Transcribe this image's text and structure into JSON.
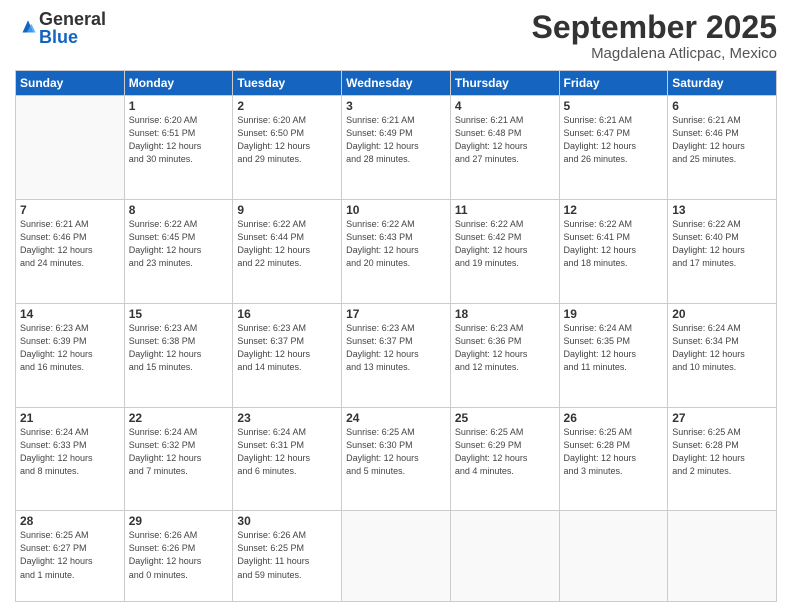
{
  "logo": {
    "general": "General",
    "blue": "Blue"
  },
  "header": {
    "month": "September 2025",
    "location": "Magdalena Atlicpac, Mexico"
  },
  "days_of_week": [
    "Sunday",
    "Monday",
    "Tuesday",
    "Wednesday",
    "Thursday",
    "Friday",
    "Saturday"
  ],
  "weeks": [
    [
      {
        "day": "",
        "info": ""
      },
      {
        "day": "1",
        "info": "Sunrise: 6:20 AM\nSunset: 6:51 PM\nDaylight: 12 hours\nand 30 minutes."
      },
      {
        "day": "2",
        "info": "Sunrise: 6:20 AM\nSunset: 6:50 PM\nDaylight: 12 hours\nand 29 minutes."
      },
      {
        "day": "3",
        "info": "Sunrise: 6:21 AM\nSunset: 6:49 PM\nDaylight: 12 hours\nand 28 minutes."
      },
      {
        "day": "4",
        "info": "Sunrise: 6:21 AM\nSunset: 6:48 PM\nDaylight: 12 hours\nand 27 minutes."
      },
      {
        "day": "5",
        "info": "Sunrise: 6:21 AM\nSunset: 6:47 PM\nDaylight: 12 hours\nand 26 minutes."
      },
      {
        "day": "6",
        "info": "Sunrise: 6:21 AM\nSunset: 6:46 PM\nDaylight: 12 hours\nand 25 minutes."
      }
    ],
    [
      {
        "day": "7",
        "info": "Sunrise: 6:21 AM\nSunset: 6:46 PM\nDaylight: 12 hours\nand 24 minutes."
      },
      {
        "day": "8",
        "info": "Sunrise: 6:22 AM\nSunset: 6:45 PM\nDaylight: 12 hours\nand 23 minutes."
      },
      {
        "day": "9",
        "info": "Sunrise: 6:22 AM\nSunset: 6:44 PM\nDaylight: 12 hours\nand 22 minutes."
      },
      {
        "day": "10",
        "info": "Sunrise: 6:22 AM\nSunset: 6:43 PM\nDaylight: 12 hours\nand 20 minutes."
      },
      {
        "day": "11",
        "info": "Sunrise: 6:22 AM\nSunset: 6:42 PM\nDaylight: 12 hours\nand 19 minutes."
      },
      {
        "day": "12",
        "info": "Sunrise: 6:22 AM\nSunset: 6:41 PM\nDaylight: 12 hours\nand 18 minutes."
      },
      {
        "day": "13",
        "info": "Sunrise: 6:22 AM\nSunset: 6:40 PM\nDaylight: 12 hours\nand 17 minutes."
      }
    ],
    [
      {
        "day": "14",
        "info": "Sunrise: 6:23 AM\nSunset: 6:39 PM\nDaylight: 12 hours\nand 16 minutes."
      },
      {
        "day": "15",
        "info": "Sunrise: 6:23 AM\nSunset: 6:38 PM\nDaylight: 12 hours\nand 15 minutes."
      },
      {
        "day": "16",
        "info": "Sunrise: 6:23 AM\nSunset: 6:37 PM\nDaylight: 12 hours\nand 14 minutes."
      },
      {
        "day": "17",
        "info": "Sunrise: 6:23 AM\nSunset: 6:37 PM\nDaylight: 12 hours\nand 13 minutes."
      },
      {
        "day": "18",
        "info": "Sunrise: 6:23 AM\nSunset: 6:36 PM\nDaylight: 12 hours\nand 12 minutes."
      },
      {
        "day": "19",
        "info": "Sunrise: 6:24 AM\nSunset: 6:35 PM\nDaylight: 12 hours\nand 11 minutes."
      },
      {
        "day": "20",
        "info": "Sunrise: 6:24 AM\nSunset: 6:34 PM\nDaylight: 12 hours\nand 10 minutes."
      }
    ],
    [
      {
        "day": "21",
        "info": "Sunrise: 6:24 AM\nSunset: 6:33 PM\nDaylight: 12 hours\nand 8 minutes."
      },
      {
        "day": "22",
        "info": "Sunrise: 6:24 AM\nSunset: 6:32 PM\nDaylight: 12 hours\nand 7 minutes."
      },
      {
        "day": "23",
        "info": "Sunrise: 6:24 AM\nSunset: 6:31 PM\nDaylight: 12 hours\nand 6 minutes."
      },
      {
        "day": "24",
        "info": "Sunrise: 6:25 AM\nSunset: 6:30 PM\nDaylight: 12 hours\nand 5 minutes."
      },
      {
        "day": "25",
        "info": "Sunrise: 6:25 AM\nSunset: 6:29 PM\nDaylight: 12 hours\nand 4 minutes."
      },
      {
        "day": "26",
        "info": "Sunrise: 6:25 AM\nSunset: 6:28 PM\nDaylight: 12 hours\nand 3 minutes."
      },
      {
        "day": "27",
        "info": "Sunrise: 6:25 AM\nSunset: 6:28 PM\nDaylight: 12 hours\nand 2 minutes."
      }
    ],
    [
      {
        "day": "28",
        "info": "Sunrise: 6:25 AM\nSunset: 6:27 PM\nDaylight: 12 hours\nand 1 minute."
      },
      {
        "day": "29",
        "info": "Sunrise: 6:26 AM\nSunset: 6:26 PM\nDaylight: 12 hours\nand 0 minutes."
      },
      {
        "day": "30",
        "info": "Sunrise: 6:26 AM\nSunset: 6:25 PM\nDaylight: 11 hours\nand 59 minutes."
      },
      {
        "day": "",
        "info": ""
      },
      {
        "day": "",
        "info": ""
      },
      {
        "day": "",
        "info": ""
      },
      {
        "day": "",
        "info": ""
      }
    ]
  ]
}
